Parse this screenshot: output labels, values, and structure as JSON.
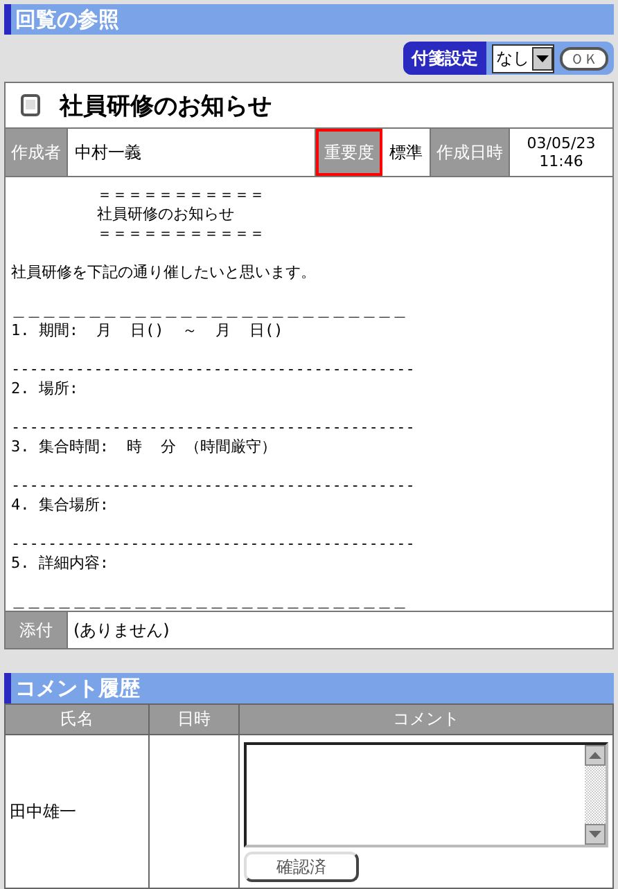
{
  "page_title": "回覧の参照",
  "tag_setting": {
    "label": "付箋設定",
    "value": "なし",
    "ok": "ＯＫ"
  },
  "circular": {
    "title": "社員研修のお知らせ",
    "meta": [
      {
        "kind": "label",
        "text": "作成者",
        "highlighted": false
      },
      {
        "kind": "value",
        "text": "中村一義"
      },
      {
        "kind": "label",
        "text": "重要度",
        "highlighted": true
      },
      {
        "kind": "value",
        "text": "標準"
      },
      {
        "kind": "label",
        "text": "作成日時",
        "highlighted": false
      },
      {
        "kind": "datetime",
        "text": "03/05/23\n11:46"
      }
    ],
    "body": [
      {
        "kind": "heading",
        "lines": [
          "＝＝＝＝＝＝＝＝＝＝＝",
          "社員研修のお知らせ",
          "＝＝＝＝＝＝＝＝＝＝＝"
        ]
      },
      {
        "kind": "text",
        "lines": [
          "社員研修を下記の通り催したいと思います。"
        ]
      },
      {
        "kind": "text",
        "lines": [
          "＿＿＿＿＿＿＿＿＿＿＿＿＿＿＿＿＿＿＿＿＿＿＿＿＿＿",
          "1. 期間:  月  日()  ～  月  日()"
        ]
      },
      {
        "kind": "text",
        "lines": [
          "--------------------------------------------",
          "2. 場所:"
        ]
      },
      {
        "kind": "text",
        "lines": [
          "--------------------------------------------",
          "3. 集合時間:  時  分 （時間厳守）"
        ]
      },
      {
        "kind": "text",
        "lines": [
          "--------------------------------------------",
          "4. 集合場所:"
        ]
      },
      {
        "kind": "text",
        "lines": [
          "--------------------------------------------",
          "5. 詳細内容:"
        ]
      },
      {
        "kind": "text",
        "lines": [
          "＿＿＿＿＿＿＿＿＿＿＿＿＿＿＿＿＿＿＿＿＿＿＿＿＿＿"
        ]
      }
    ],
    "attachment": {
      "label": "添付",
      "value": "(ありません)"
    }
  },
  "comments": {
    "title": "コメント履歴",
    "columns": [
      "氏名",
      "日時",
      "コメント"
    ],
    "rows": [
      {
        "name": "田中雄一",
        "button": "確認済"
      }
    ]
  }
}
